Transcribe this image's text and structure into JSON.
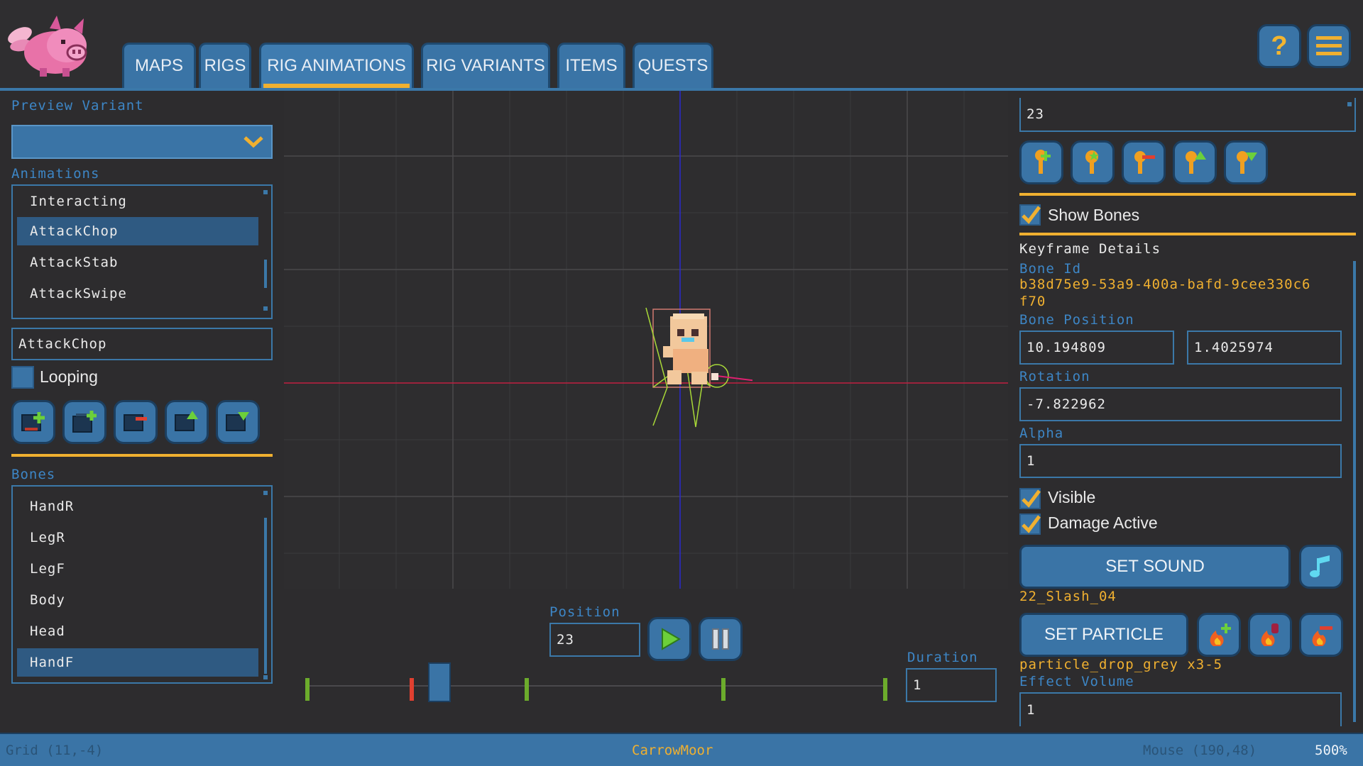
{
  "tabs": [
    {
      "label": "MAPS",
      "active": false
    },
    {
      "label": "RIGS",
      "active": false
    },
    {
      "label": "RIG ANIMATIONS",
      "active": true
    },
    {
      "label": "RIG VARIANTS",
      "active": false
    },
    {
      "label": "ITEMS",
      "active": false
    },
    {
      "label": "QUESTS",
      "active": false
    }
  ],
  "header": {
    "help_icon": "question-icon",
    "menu_icon": "hamburger-icon",
    "help_glyph": "?"
  },
  "left": {
    "preview_variant_label": "Preview Variant",
    "preview_variant_value": "",
    "animations_label": "Animations",
    "animations": [
      "Interacting",
      "AttackChop",
      "AttackStab",
      "AttackSwipe"
    ],
    "selected_animation_index": 1,
    "animation_name": "AttackChop",
    "looping_label": "Looping",
    "looping_checked": false,
    "bones_label": "Bones",
    "bones": [
      "HandR",
      "LegR",
      "LegF",
      "Body",
      "Head",
      "HandF"
    ],
    "selected_bone_index": 5
  },
  "timeline": {
    "position_label": "Position",
    "position_value": "23",
    "duration_label": "Duration",
    "duration_value": "1",
    "markers": [
      {
        "t": 0.0,
        "color": "#6cac2c"
      },
      {
        "t": 0.18,
        "color": "#e04030"
      },
      {
        "t": 0.38,
        "color": "#6cac2c"
      },
      {
        "t": 0.72,
        "color": "#6cac2c"
      },
      {
        "t": 1.0,
        "color": "#6cac2c"
      }
    ],
    "cursor_t": 0.23
  },
  "right": {
    "top_field_value": "23",
    "show_bones_label": "Show Bones",
    "show_bones_checked": true,
    "keyframe_details_label": "Keyframe Details",
    "bone_id_label": "Bone Id",
    "bone_id_line1": "b38d75e9-53a9-400a-bafd-9cee330c6",
    "bone_id_line2": "f70",
    "bone_position_label": "Bone Position",
    "bone_position_x": "10.194809",
    "bone_position_y": "1.4025974",
    "rotation_label": "Rotation",
    "rotation_value": "-7.822962",
    "alpha_label": "Alpha",
    "alpha_value": "1",
    "visible_label": "Visible",
    "visible_checked": true,
    "damage_active_label": "Damage Active",
    "damage_active_checked": true,
    "set_sound_label": "SET SOUND",
    "sound_name": "22_Slash_04",
    "set_particle_label": "SET PARTICLE",
    "particle_name": "particle_drop_grey x3-5",
    "effect_volume_label": "Effect Volume",
    "effect_volume_value": "1"
  },
  "status": {
    "grid": "Grid (11,-4)",
    "map": "CarrowMoor",
    "mouse": "Mouse (190,48)",
    "zoom": "500%"
  },
  "colors": {
    "accent": "#f0b030",
    "panel_blue": "#3a74a6",
    "label_blue": "#3d86c6",
    "bg": "#2d2c2e"
  }
}
